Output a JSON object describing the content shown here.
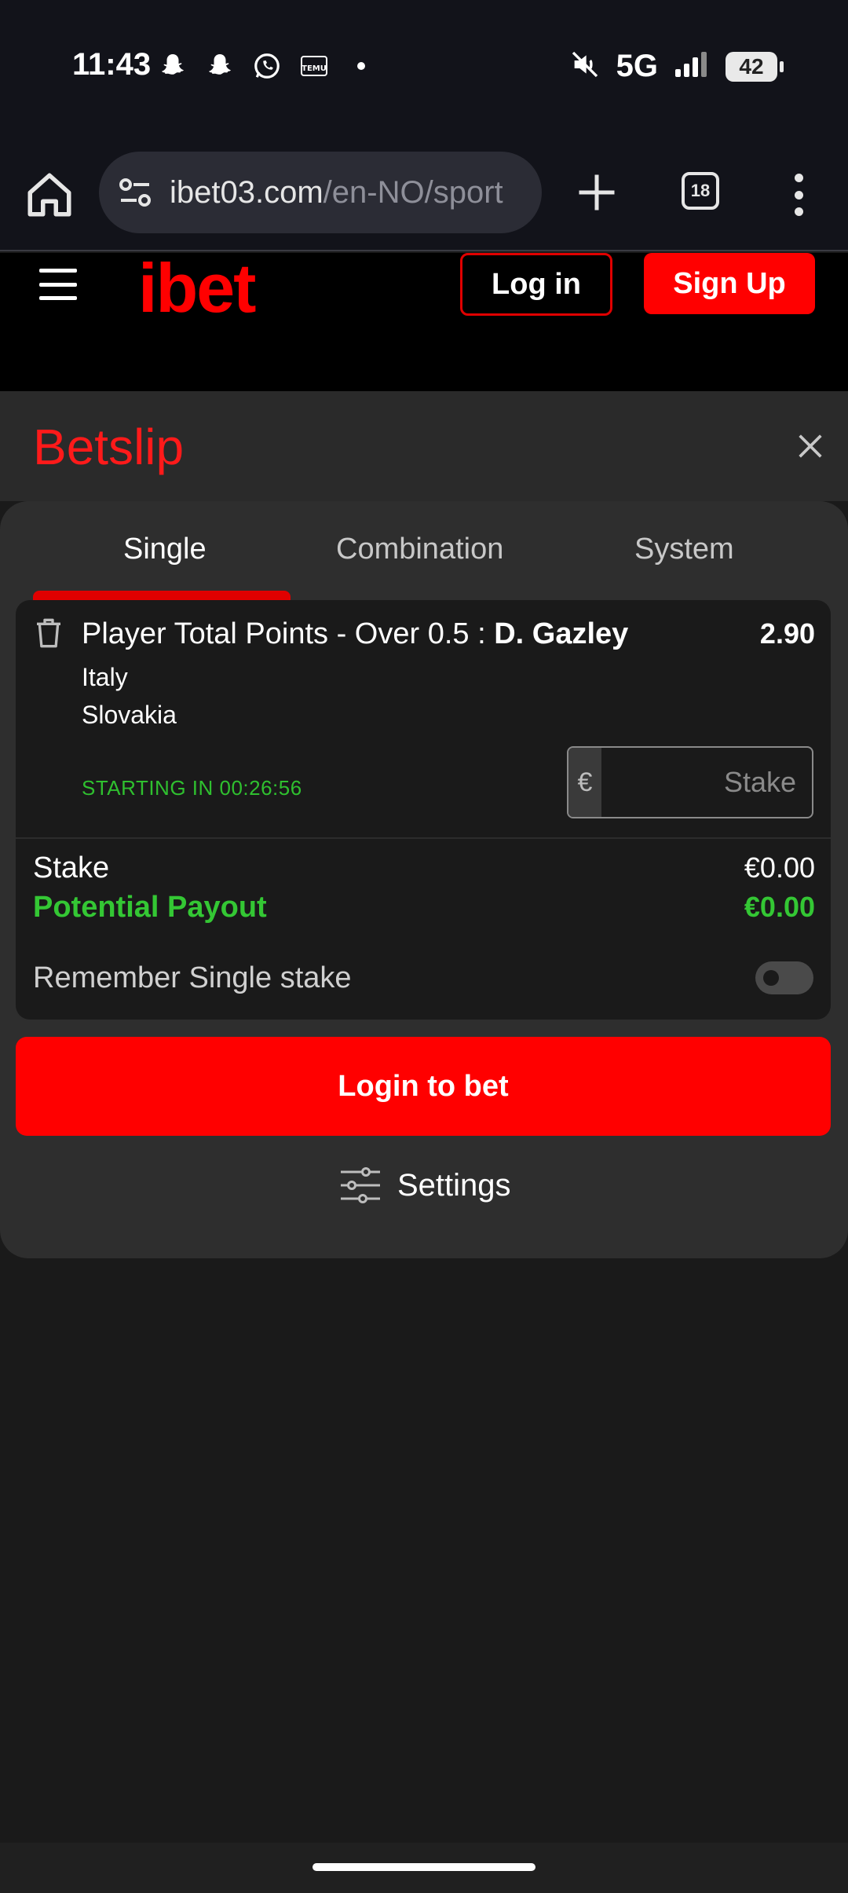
{
  "status_bar": {
    "time": "11:43",
    "network": "5G",
    "battery": "42",
    "left_icons": [
      "snapchat-icon",
      "snapchat-icon",
      "whatsapp-icon",
      "temu-icon",
      "dot-icon"
    ],
    "right_icons": [
      "mute-icon",
      "signal-icon",
      "battery-icon"
    ]
  },
  "browser": {
    "url_main": "ibet03.com",
    "url_path": "/en-NO/sport",
    "tab_count": "18"
  },
  "header": {
    "logo": "ibet",
    "login_label": "Log in",
    "signup_label": "Sign Up",
    "brand_color": "#ff0000"
  },
  "betslip": {
    "title": "Betslip",
    "tabs": [
      {
        "label": "Single",
        "active": true
      },
      {
        "label": "Combination",
        "active": false
      },
      {
        "label": "System",
        "active": false
      }
    ],
    "bet": {
      "market": "Player Total Points - Over 0.5 : ",
      "player": "D. Gazley",
      "odds": "2.90",
      "team_home": "Italy",
      "team_away": "Slovakia",
      "starting": "STARTING IN 00:26:56",
      "currency": "€",
      "stake_placeholder": "Stake",
      "stake_value": ""
    },
    "summary": {
      "stake_label": "Stake",
      "stake_value": "€0.00",
      "payout_label": "Potential Payout",
      "payout_value": "€0.00"
    },
    "remember_label": "Remember Single stake",
    "remember_on": false,
    "login_to_bet": "Login to bet",
    "settings_label": "Settings"
  }
}
